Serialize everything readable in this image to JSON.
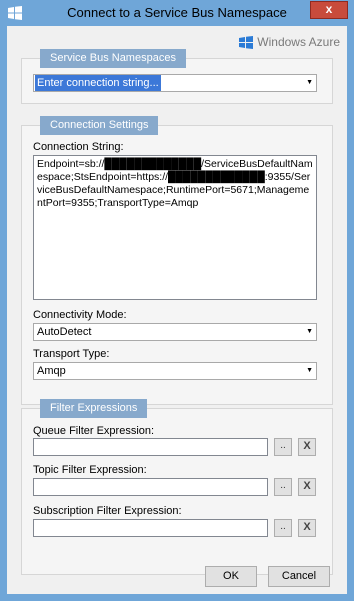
{
  "window": {
    "title": "Connect to a Service Bus Namespace",
    "close_label": "x",
    "brand": "Windows Azure"
  },
  "namespaces_group": {
    "title": "Service Bus Namespaces",
    "combo_value": "Enter connection string..."
  },
  "connection_group": {
    "title": "Connection Settings",
    "connection_string_label": "Connection String:",
    "connection_string_value": "Endpoint=sb://█████████████/ServiceBusDefaultNamespace;StsEndpoint=https://█████████████:9355/ServiceBusDefaultNamespace;RuntimePort=5671;ManagementPort=9355;TransportType=Amqp",
    "connectivity_label": "Connectivity Mode:",
    "connectivity_value": "AutoDetect",
    "transport_label": "Transport Type:",
    "transport_value": "Amqp"
  },
  "filter_group": {
    "title": "Filter Expressions",
    "queue_label": "Queue Filter Expression:",
    "topic_label": "Topic Filter Expression:",
    "subscription_label": "Subscription Filter Expression:",
    "browse_label": "..",
    "clear_label": "X"
  },
  "buttons": {
    "ok": "OK",
    "cancel": "Cancel"
  }
}
